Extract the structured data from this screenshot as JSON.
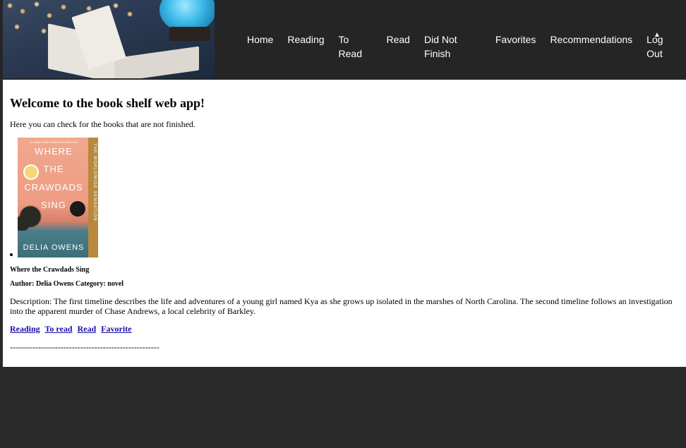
{
  "header": {
    "nav": [
      "Home",
      "Reading",
      "To Read",
      "Read",
      "Did Not Finish",
      "Favorites",
      "Recommendations",
      "Log Out"
    ]
  },
  "main": {
    "heading": "Welcome to the book shelf web app!",
    "intro": "Here you can check for the books that are not finished.",
    "book": {
      "cover": {
        "top_line": "#1 NEW YORK TIMES BESTSELLER",
        "title_lines": [
          "WHERE",
          "THE",
          "CRAWDADS",
          "SING"
        ],
        "spine": "THE WORLDWIDE SENSATION",
        "author": "DELIA OWENS"
      },
      "title": "Where the Crawdads Sing",
      "meta": "Author: Delia Owens Category: novel",
      "description": "Description: The first timeline describes the life and adventures of a young girl named Kya as she grows up isolated in the marshes of North Carolina. The second timeline follows an investigation into the apparent murder of Chase Andrews, a local celebrity of Barkley.",
      "actions": [
        "Reading",
        "To read",
        "Read",
        "Favorite"
      ]
    },
    "divider": "-----------------------------------------------------"
  }
}
